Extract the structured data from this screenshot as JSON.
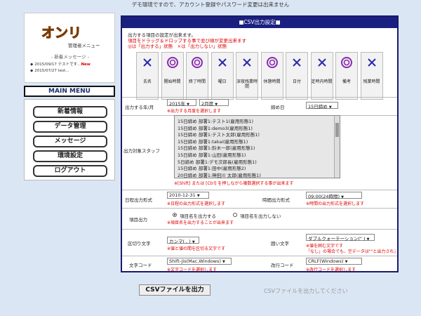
{
  "notice": "デモ環境ですので、アカウント登録やパスワード変更は出来ません",
  "sidebar": {
    "logo_text": "オンリメ!",
    "subtitle": "管理者メニュー",
    "news_heading": "- 新着メッセージ -",
    "news": [
      {
        "text": "2015/09/17 テストです",
        "badge": "New"
      },
      {
        "text": "2015/07/27 test",
        "badge": ""
      }
    ],
    "main_menu": "MAIN MENU",
    "menu": [
      "新着情報",
      "データ管理",
      "メッセージ",
      "環境設定",
      "ログアウト"
    ]
  },
  "panel": {
    "title": "■CSV出力設定■",
    "instructions": [
      "出力する項目の設定が出来ます。",
      "項目をドラッグ＆ドロップする事で並び順が変更出来ます",
      "◎は「出力する」状態　×は「出力しない」状態"
    ],
    "columns": [
      {
        "label": "氏名",
        "state": "×"
      },
      {
        "label": "開始時間",
        "state": "◎"
      },
      {
        "label": "終了時間",
        "state": "◎"
      },
      {
        "label": "曜日",
        "state": "×"
      },
      {
        "label": "深夜残業時間",
        "state": "×"
      },
      {
        "label": "休憩時間",
        "state": "◎"
      },
      {
        "label": "日付",
        "state": "×"
      },
      {
        "label": "定時内時間",
        "state": "×"
      },
      {
        "label": "備考",
        "state": "◎"
      },
      {
        "label": "残業時間",
        "state": "×"
      }
    ],
    "month": {
      "label": "出力する年/月",
      "year": "2015年",
      "month": "2月度",
      "hint": "※出力する月度を選択します",
      "closing_label": "締め日",
      "closing_value": "15日締め"
    },
    "staff": {
      "label": "出力対象スタッフ",
      "items": [
        "15日締め 部署1:テスト1(雇用形態1)",
        "15日締め 部署1:demo3(雇用形態1)",
        "15日締め 部署1:テスト太郎(雇用形態1)",
        "15日締め 部署1:takai(雇用形態1)",
        "15日締め 部署1:鈴木一郎(雇用形態1)",
        "15日締め 部署1:山田(雇用形態1)",
        "5日締め 部署1:デモ次郎長(雇用形態1)",
        "15日締め 部署1:田中(雇用形態2)",
        "20日締め 部署1:神田川 太郎(雇用形態1)"
      ],
      "hint": "※[Shift] または [Ctrl] を押しながら複数選択する事が出来ます"
    },
    "date_format": {
      "label": "日程出力形式",
      "value": "2010-12-31",
      "hint": "※日程の出力形式を選択します",
      "time_label": "時間出力形式",
      "time_value": "09:00(24時間)",
      "time_hint": "※時間の出力形式を選択します"
    },
    "header_output": {
      "label": "項目出力",
      "opt_yes": "項目名を出力する",
      "opt_no": "項目名を出力しない",
      "hint": "※項目名を出力することが出来ます"
    },
    "delimiter": {
      "label": "区切り文字",
      "value": "カンマ( , )",
      "hint": "※値と値の間を区切る文字です",
      "quote_label": "囲い文字",
      "quote_value": "ダブルクォーテーション(\" )",
      "quote_hint1": "※値を囲む文字です",
      "quote_hint2": "「なし」の場合でも、空データは\"\"と出力されます"
    },
    "encoding": {
      "label": "文字コード",
      "value": "Shift-Jis(Mac,Windows)",
      "hint": "※文字コードを選択します",
      "newline_label": "改行コード",
      "newline_value": "CRLF(Windows)",
      "newline_hint": "※改行コードを選択します"
    }
  },
  "output_button": "CSVファイルを出力",
  "output_disabled": "CSVファイルを出力してください"
}
